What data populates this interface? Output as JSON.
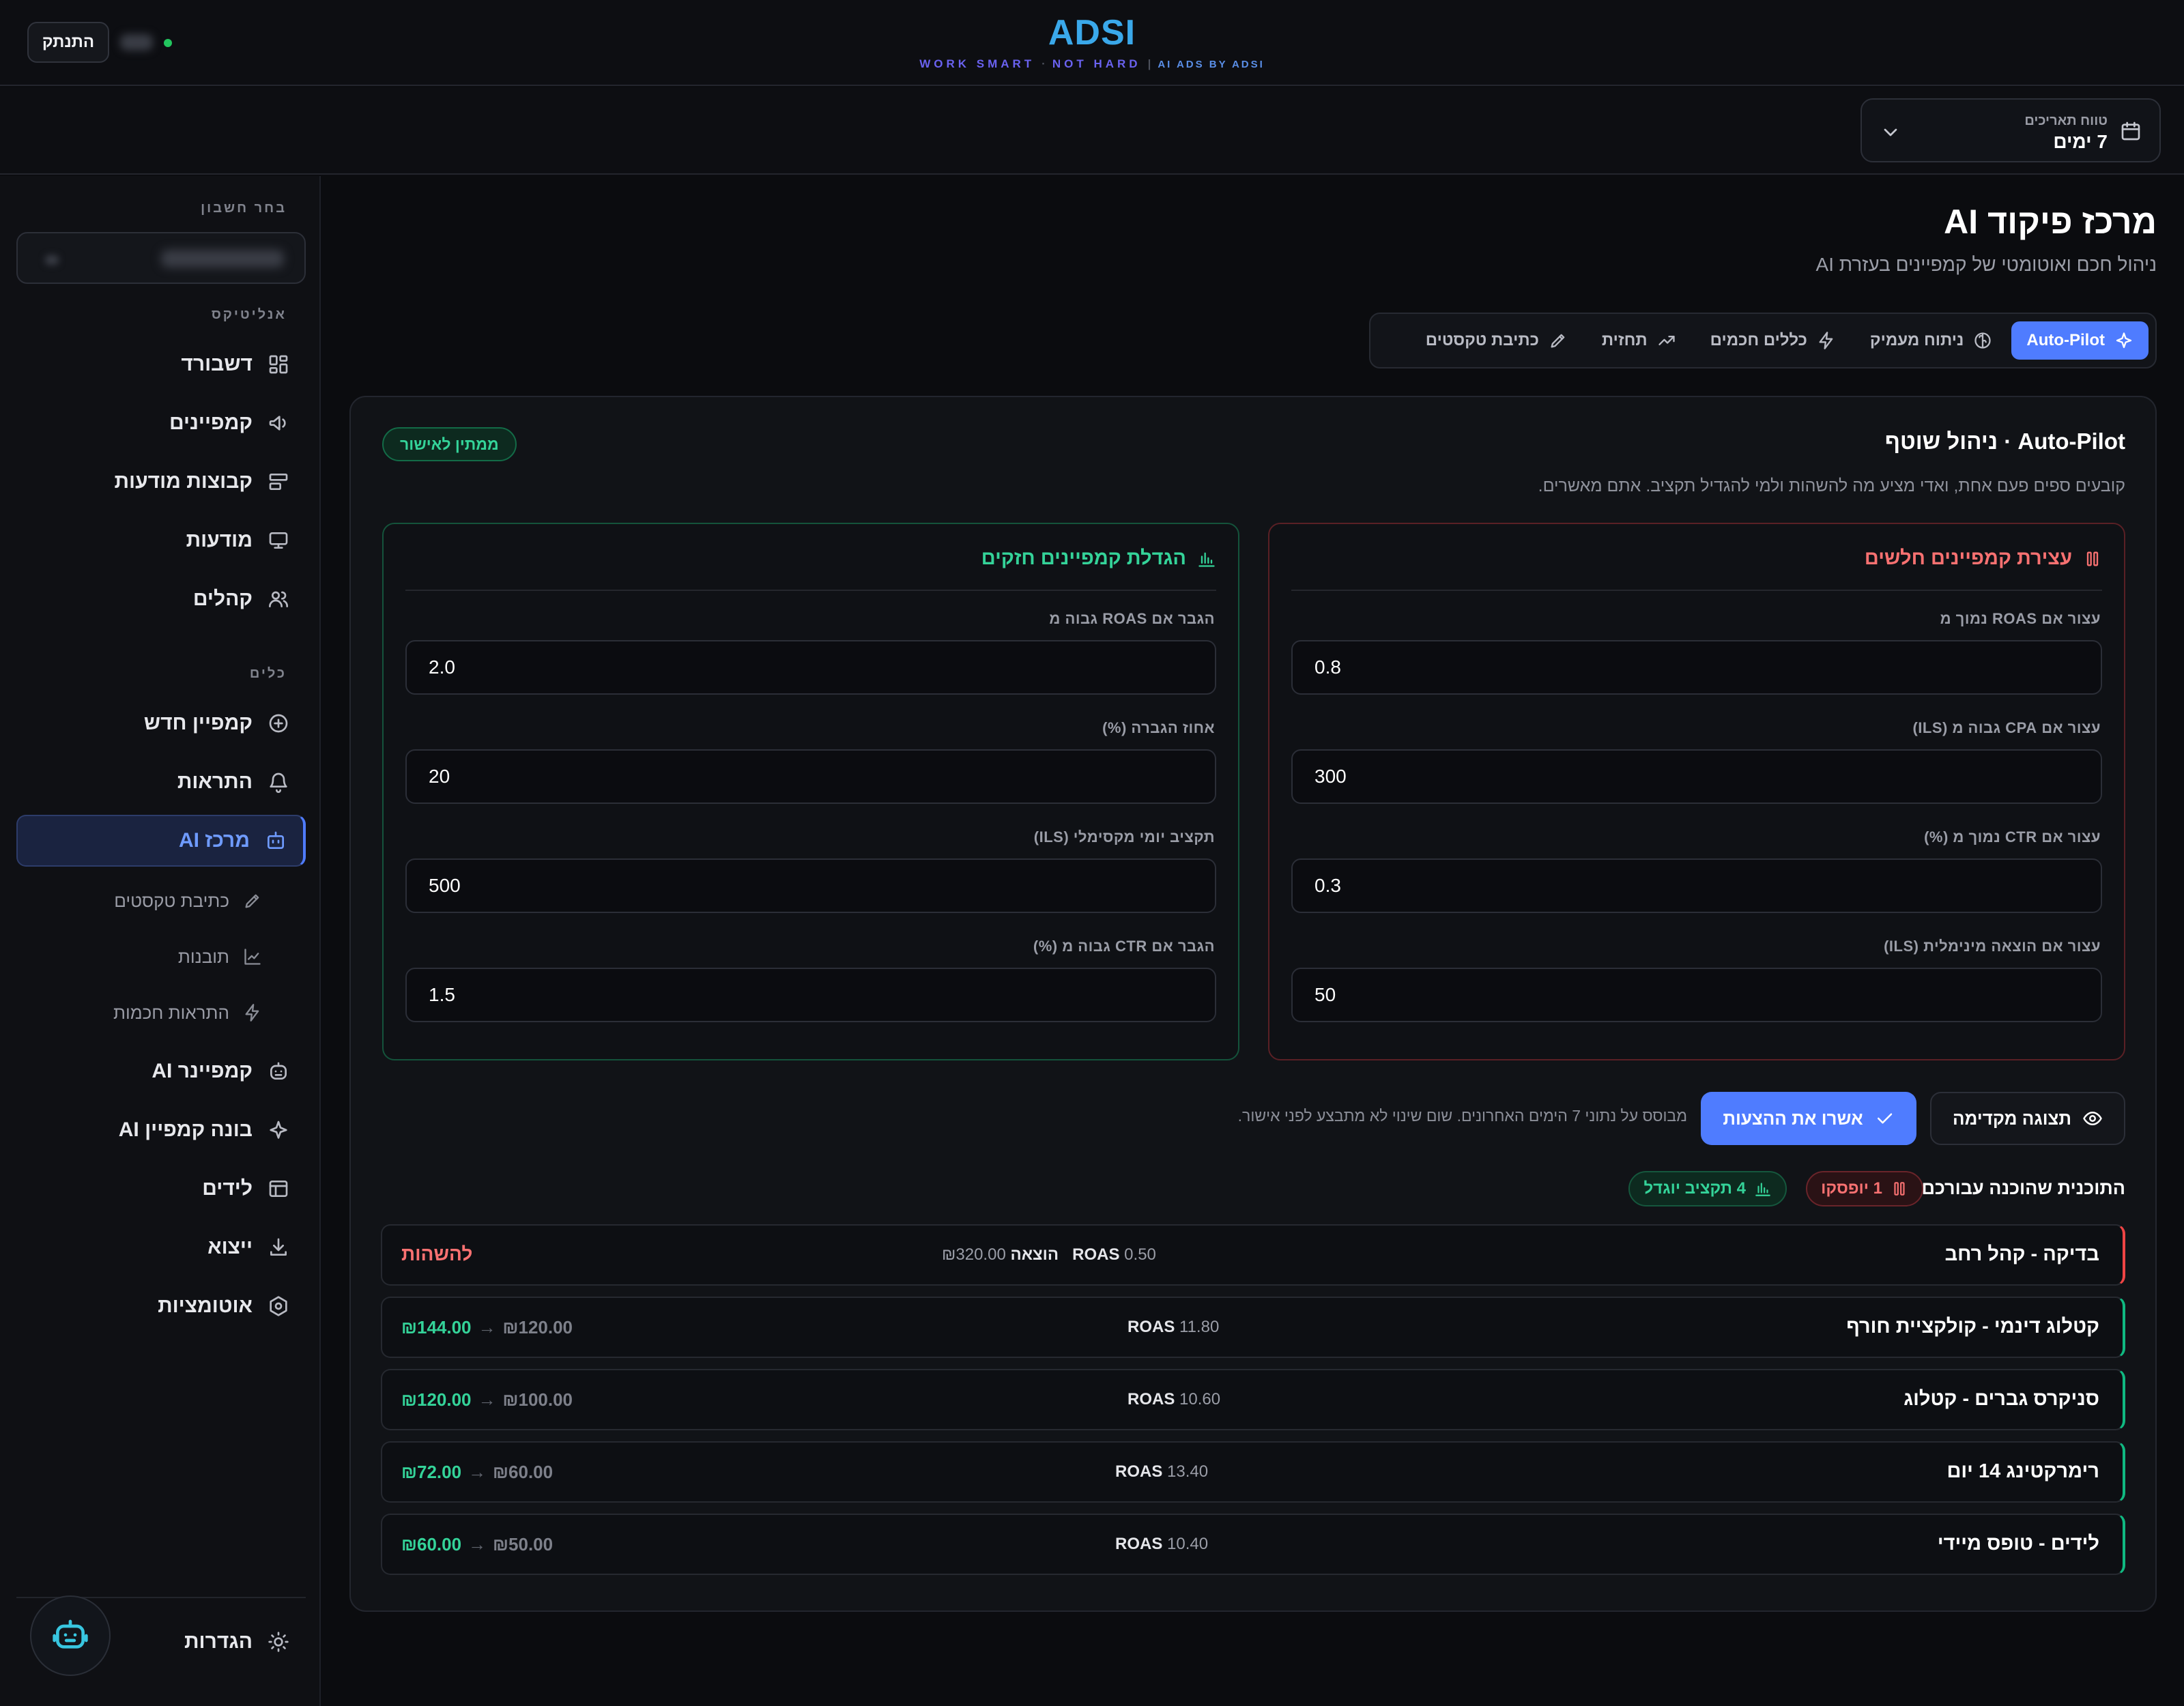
{
  "header": {
    "logout_label": "התנתק",
    "brand_name": "ADSI",
    "tagline_part1": "WORK SMART",
    "tagline_sep": "·",
    "tagline_part2": "NOT HARD",
    "tagline_pipe": "|",
    "tagline_sub": "AI ADS BY ADSI"
  },
  "date_range": {
    "label": "טווח תאריכים",
    "value": "7 ימים"
  },
  "sidebar": {
    "account_section": "בחר חשבון",
    "analytics_section": "אנליטיקס",
    "tools_section": "כלים",
    "items": [
      {
        "label": "דשבורד",
        "icon": "grid-icon"
      },
      {
        "label": "קמפיינים",
        "icon": "megaphone-icon"
      },
      {
        "label": "קבוצות מודעות",
        "icon": "layers-icon"
      },
      {
        "label": "מודעות",
        "icon": "monitor-icon"
      },
      {
        "label": "קהלים",
        "icon": "users-icon"
      }
    ],
    "tools": [
      {
        "label": "קמפיין חדש",
        "icon": "plus-circle-icon"
      },
      {
        "label": "התראות",
        "icon": "bell-icon"
      },
      {
        "label": "מרכז AI",
        "icon": "robot-icon",
        "active": true
      }
    ],
    "sub_items": [
      {
        "label": "כתיבת טקסטים",
        "icon": "pen-icon"
      },
      {
        "label": "תובנות",
        "icon": "line-chart-icon"
      },
      {
        "label": "התראות חכמות",
        "icon": "bolt-icon"
      }
    ],
    "more": [
      {
        "label": "קמפיינר AI",
        "icon": "bot-face-icon"
      },
      {
        "label": "בונה קמפיין AI",
        "icon": "sparkle-icon"
      },
      {
        "label": "לידים",
        "icon": "table-icon"
      },
      {
        "label": "ייצוא",
        "icon": "download-icon"
      },
      {
        "label": "אוטומציות",
        "icon": "cog-icon"
      }
    ],
    "settings_label": "הגדרות"
  },
  "page": {
    "title": "מרכז פיקוד AI",
    "subtitle": "ניהול חכם ואוטומטי של קמפיינים בעזרת AI"
  },
  "tabs": [
    {
      "label": "Auto-Pilot",
      "icon": "sparkle-icon",
      "active": true
    },
    {
      "label": "ניתוח מעמיק",
      "icon": "brain-icon"
    },
    {
      "label": "כללים חכמים",
      "icon": "bolt-icon"
    },
    {
      "label": "תחזית",
      "icon": "trend-up-icon"
    },
    {
      "label": "כתיבת טקסטים",
      "icon": "pen-icon"
    }
  ],
  "autopilot": {
    "title": "Auto-Pilot · ניהול שוטף",
    "description": "קובעים ספים פעם אחת, ואדי מציע מה להשהות ולמי להגדיל תקציב. אתם מאשרים.",
    "status_badge": "ממתין לאישור",
    "pause_panel": {
      "title": "עצירת קמפיינים חלשים",
      "fields": [
        {
          "label": "עצור אם ROAS נמוך מ",
          "value": "0.8"
        },
        {
          "label": "עצור אם CPA גבוה מ (ILS)",
          "value": "300"
        },
        {
          "label": "עצור אם CTR נמוך מ (%)",
          "value": "0.3"
        },
        {
          "label": "עצור אם הוצאה מינימלית (ILS)",
          "value": "50"
        }
      ]
    },
    "scale_panel": {
      "title": "הגדלת קמפיינים חזקים",
      "fields": [
        {
          "label": "הגבר אם ROAS גבוה מ",
          "value": "2.0"
        },
        {
          "label": "אחוז הגברה (%)",
          "value": "20"
        },
        {
          "label": "תקציב יומי מקסימלי (ILS)",
          "value": "500"
        },
        {
          "label": "הגבר אם CTR גבוה מ (%)",
          "value": "1.5"
        }
      ]
    },
    "preview_label": "תצוגה מקדימה",
    "approve_label": "אשרו את ההצעות",
    "note": "מבוסס על נתוני 7 הימים האחרונים. שום שינוי לא מתבצע לפני אישור.",
    "plan_label": "התוכנית שהוכנה עבורכם:",
    "paused_chip": "1 יופסקו",
    "scaled_chip": "4 תקציב יוגדל",
    "campaigns": [
      {
        "name": "בדיקה - קהל רחב",
        "roas_label": "ROAS",
        "roas": "0.50",
        "spend_label": "הוצאה",
        "spend": "₪320.00",
        "action": "להשהות",
        "type": "pause"
      },
      {
        "name": "קטלוג דינמי - קולקציית חורף",
        "roas_label": "ROAS",
        "roas": "11.80",
        "old_budget": "₪120.00",
        "arrow": "→",
        "new_budget": "₪144.00",
        "type": "grow"
      },
      {
        "name": "סניקרס גברים - קטלוג",
        "roas_label": "ROAS",
        "roas": "10.60",
        "old_budget": "₪100.00",
        "arrow": "→",
        "new_budget": "₪120.00",
        "type": "grow"
      },
      {
        "name": "רימרקטינג 14 יום",
        "roas_label": "ROAS",
        "roas": "13.40",
        "old_budget": "₪60.00",
        "arrow": "→",
        "new_budget": "₪72.00",
        "type": "grow"
      },
      {
        "name": "לידים - טופס מיידי",
        "roas_label": "ROAS",
        "roas": "10.40",
        "old_budget": "₪50.00",
        "arrow": "→",
        "new_budget": "₪60.00",
        "type": "grow"
      }
    ]
  },
  "colors": {
    "accent": "#4f7cff",
    "danger": "#f87171",
    "success": "#34d399",
    "brand": "#3aa8ea"
  }
}
